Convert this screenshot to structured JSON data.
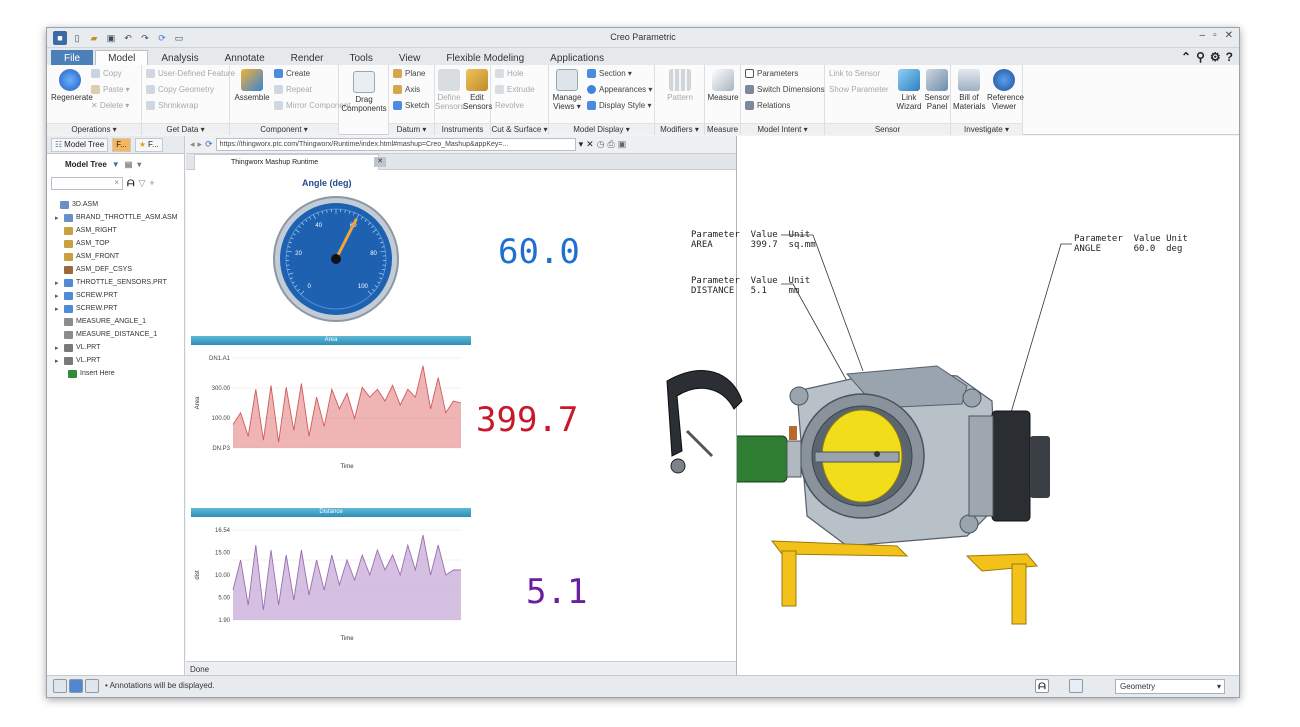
{
  "window": {
    "title": "Creo Parametric"
  },
  "tabs": [
    "File",
    "Model",
    "Analysis",
    "Annotate",
    "Render",
    "Tools",
    "View",
    "Flexible Modeling",
    "Applications"
  ],
  "active_tab": "Model",
  "ribbon": {
    "operations": {
      "label": "Operations ▾",
      "regenerate": "Regenerate",
      "copy": "Copy",
      "paste": "Paste ▾",
      "delete": "✕ Delete ▾"
    },
    "get_data": {
      "label": "Get Data ▾",
      "udf": "User-Defined Feature",
      "copy_geometry": "Copy Geometry",
      "shrinkwrap": "Shrinkwrap"
    },
    "component": {
      "label": "Component ▾",
      "assemble": "Assemble",
      "create": "Create",
      "repeat": "Repeat",
      "mirror": "Mirror Component"
    },
    "drag": {
      "label": "Drag Components"
    },
    "datum": {
      "label": "Datum ▾",
      "plane": "Plane",
      "axis": "Axis",
      "sketch": "Sketch"
    },
    "instruments": {
      "label": "Instruments",
      "define": "Define Sensors",
      "edit": "Edit Sensors"
    },
    "cut_surface": {
      "label": "Cut & Surface ▾",
      "hole": "Hole",
      "extrude": "Extrude",
      "revolve": "Revolve"
    },
    "model_display": {
      "label": "Model Display ▾",
      "manage": "Manage Views ▾",
      "section": "Section ▾",
      "appearances": "Appearances ▾",
      "display_style": "Display Style ▾"
    },
    "modifiers": {
      "label": "Modifiers ▾",
      "pattern": "Pattern"
    },
    "measure": {
      "label": "Measure",
      "btn": "Measure"
    },
    "model_intent": {
      "label": "Model Intent ▾",
      "parameters": "Parameters",
      "switch": "Switch Dimensions",
      "relations": "Relations"
    },
    "sensor": {
      "label": "Sensor",
      "link": "Link to Sensor",
      "show": "Show Parameter",
      "link_wizard": "Link Wizard",
      "sensor_panel": "Sensor Panel"
    },
    "investigate": {
      "label": "Investigate ▾",
      "bill": "Bill of Materials",
      "ref": "Reference Viewer"
    }
  },
  "left_panel": {
    "tab1": "Model Tree",
    "tab2": "F...",
    "tab3": "F...",
    "toolbar_label": "Model Tree",
    "search_x": "×",
    "tree": [
      {
        "label": "3D.ASM",
        "indent": 0,
        "expand": "",
        "color": "#6b8fc7"
      },
      {
        "label": "BRAND_THROTTLE_ASM.ASM",
        "indent": 1,
        "expand": "▸",
        "color": "#6b8fc7"
      },
      {
        "label": "ASM_RIGHT",
        "indent": 1,
        "expand": "",
        "color": "#c8a040"
      },
      {
        "label": "ASM_TOP",
        "indent": 1,
        "expand": "",
        "color": "#c8a040"
      },
      {
        "label": "ASM_FRONT",
        "indent": 1,
        "expand": "",
        "color": "#c8a040"
      },
      {
        "label": "ASM_DEF_CSYS",
        "indent": 1,
        "expand": "",
        "color": "#9a6a3a"
      },
      {
        "label": "THROTTLE_SENSORS.PRT",
        "indent": 1,
        "expand": "▸",
        "color": "#4f8bd6"
      },
      {
        "label": "SCREW.PRT",
        "indent": 1,
        "expand": "▸",
        "color": "#4f8bd6"
      },
      {
        "label": "SCREW.PRT",
        "indent": 1,
        "expand": "▸",
        "color": "#4f8bd6"
      },
      {
        "label": "MEASURE_ANGLE_1",
        "indent": 1,
        "expand": "",
        "color": "#8c8c8c"
      },
      {
        "label": "MEASURE_DISTANCE_1",
        "indent": 1,
        "expand": "",
        "color": "#8c8c8c"
      },
      {
        "label": "VL.PRT",
        "indent": 1,
        "expand": "▸",
        "color": "#7a7a7a"
      },
      {
        "label": "VL.PRT",
        "indent": 1,
        "expand": "▸",
        "color": "#7a7a7a"
      },
      {
        "label": "Insert Here",
        "indent": 2,
        "expand": "",
        "color": "#2e8b3a"
      }
    ]
  },
  "browser": {
    "url": "https://thingworx.ptc.com/Thingworx/Runtime/index.html#mashup=Creo_Mashup&appKey=...",
    "tab_title": "Thingworx Mashup Runtime",
    "status": "Done"
  },
  "mashup": {
    "gauge": {
      "title": "Angle (deg)",
      "value": 60,
      "max": 100,
      "ticks": [
        "0",
        "20",
        "40",
        "60",
        "80",
        "100"
      ]
    },
    "angle_display": "60.0",
    "area_display": "399.7",
    "distance_display": "5.1",
    "area_panel": {
      "title": "Area",
      "ylabel": "Area",
      "xlabel": "Time",
      "yticks": [
        "DN1.A1",
        "300.00",
        "100.00",
        "DN.P3"
      ]
    },
    "distance_panel": {
      "title": "Distance",
      "ylabel": "dist",
      "xlabel": "Time",
      "yticks": [
        "16.54",
        "15.00",
        "10.00",
        "5.00",
        "1.90"
      ]
    },
    "colors": {
      "angle": "#1f6fd1",
      "area": "#c8182a",
      "distance": "#6a1fa3"
    }
  },
  "chart_data": [
    {
      "type": "area",
      "title": "Area",
      "ylabel": "Area",
      "xlabel": "Time",
      "ylim": [
        0,
        460
      ],
      "series": [
        {
          "values": [
            120,
            180,
            60,
            300,
            40,
            320,
            30,
            310,
            90,
            330,
            60,
            260,
            110,
            300,
            200,
            280,
            150,
            310,
            260,
            300,
            240,
            320,
            220,
            300,
            260,
            420,
            200,
            360,
            180,
            240,
            230
          ]
        }
      ]
    },
    {
      "type": "area",
      "title": "Distance",
      "ylabel": "dist",
      "xlabel": "Time",
      "ylim": [
        0,
        18
      ],
      "series": [
        {
          "values": [
            6,
            12,
            3,
            15,
            2,
            14,
            3,
            13,
            4,
            14,
            5,
            12,
            6,
            13,
            7,
            12,
            8,
            13,
            9,
            14,
            10,
            13,
            9,
            15,
            10,
            17,
            9,
            15,
            9,
            10,
            10
          ]
        }
      ]
    }
  ],
  "viewer": {
    "area_block": "Parameter  Value  Unit\nAREA       399.7  sq.mm",
    "distance_block": "Parameter  Value  Unit\nDISTANCE   5.1    mm",
    "angle_block": "Parameter  Value Unit\nANGLE      60.0  deg"
  },
  "statusbar": {
    "message": "• Annotations will be displayed.",
    "filter": "Geometry",
    "filter_icon": "filter-icon"
  }
}
